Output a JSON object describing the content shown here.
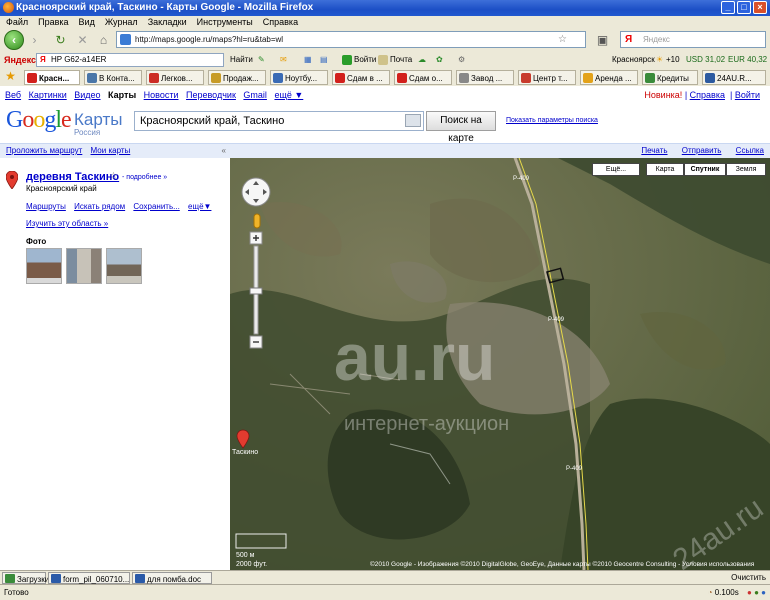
{
  "window": {
    "title": "Красноярский край, Таскино - Карты Google - Mozilla Firefox"
  },
  "menu": [
    "Файл",
    "Правка",
    "Вид",
    "Журнал",
    "Закладки",
    "Инструменты",
    "Справка"
  ],
  "nav": {
    "url": "http://maps.google.ru/maps?hl=ru&tab=wl",
    "search_placeholder": "Яндекс"
  },
  "yandex_bar": {
    "brand": "Яндекс",
    "input_value": "HP G62-a14ER",
    "find": "Найти",
    "send": "Войти",
    "mail": "Почта",
    "city": "Красноярск",
    "temp": "+10",
    "usd": "USD 31,02",
    "eur": "EUR 40,32"
  },
  "bookmarks": [
    {
      "label": "Красн...",
      "color": "#d2201c",
      "active": true
    },
    {
      "label": "В Конта...",
      "color": "#4a76a8"
    },
    {
      "label": "Легков...",
      "color": "#cc2c24"
    },
    {
      "label": "Продаж...",
      "color": "#c79b27"
    },
    {
      "label": "Ноутбу...",
      "color": "#3b6bb5"
    },
    {
      "label": "Сдам в ...",
      "color": "#d2201c"
    },
    {
      "label": "Сдам о...",
      "color": "#d2201c"
    },
    {
      "label": "Завод ...",
      "color": "#888888"
    },
    {
      "label": "Центр т...",
      "color": "#c83b2c"
    },
    {
      "label": "Аренда ...",
      "color": "#e3a21a"
    },
    {
      "label": "Кредиты",
      "color": "#3a8b3a"
    },
    {
      "label": "24AU.R...",
      "color": "#2c5aa0"
    }
  ],
  "google_top": {
    "links": [
      "Веб",
      "Картинки",
      "Видео",
      "Карты",
      "Новости",
      "Переводчик",
      "Gmail",
      "ещё ▼"
    ],
    "selected": "Карты",
    "new": "Новинка!",
    "help": "Справка",
    "signin": "Войти"
  },
  "logo": {
    "maps": "Карты",
    "country": "Россия"
  },
  "search": {
    "query": "Красноярский край, Таскино",
    "button": "Поиск на карте",
    "params": "Показать параметры поиска"
  },
  "left": {
    "route": "Проложить маршрут",
    "mymaps": "Мои карты",
    "collapse": "«",
    "place_title": "деревня Таскино",
    "more": "- подробнее »",
    "region": "Красноярский край",
    "actions": [
      "Маршруты",
      "Искать рядом",
      "Сохранить...",
      "ещё▼"
    ],
    "explore": "Изучить эту область »",
    "photos_label": "Фото"
  },
  "map": {
    "tools": [
      "Печать",
      "Отправить",
      "Ссылка"
    ],
    "more_btn": "Ещё...",
    "types": [
      "Карта",
      "Спутник",
      "Земля"
    ],
    "selected_type": "Спутник",
    "road_labels": [
      "P-409",
      "P-409",
      "P-409"
    ],
    "place_label": "Таскино",
    "scale_m": "500 м",
    "scale_ft": "2000 фут.",
    "copyright": "©2010 Google - Изображения ©2010 DigitalGlobe, GeoEye, Данные карты ©2010 Geocentre Consulting - Условия использования",
    "watermark_main": "au.ru",
    "watermark_sub": "интернет-аукцион",
    "watermark_corner": "24au.ru"
  },
  "taskbar": {
    "items": [
      "Загрузки",
      "form_pil_060710...",
      "для помба.doc"
    ],
    "clear": "Очистить"
  },
  "status": {
    "text": "Готово",
    "timer": "0.100s"
  }
}
